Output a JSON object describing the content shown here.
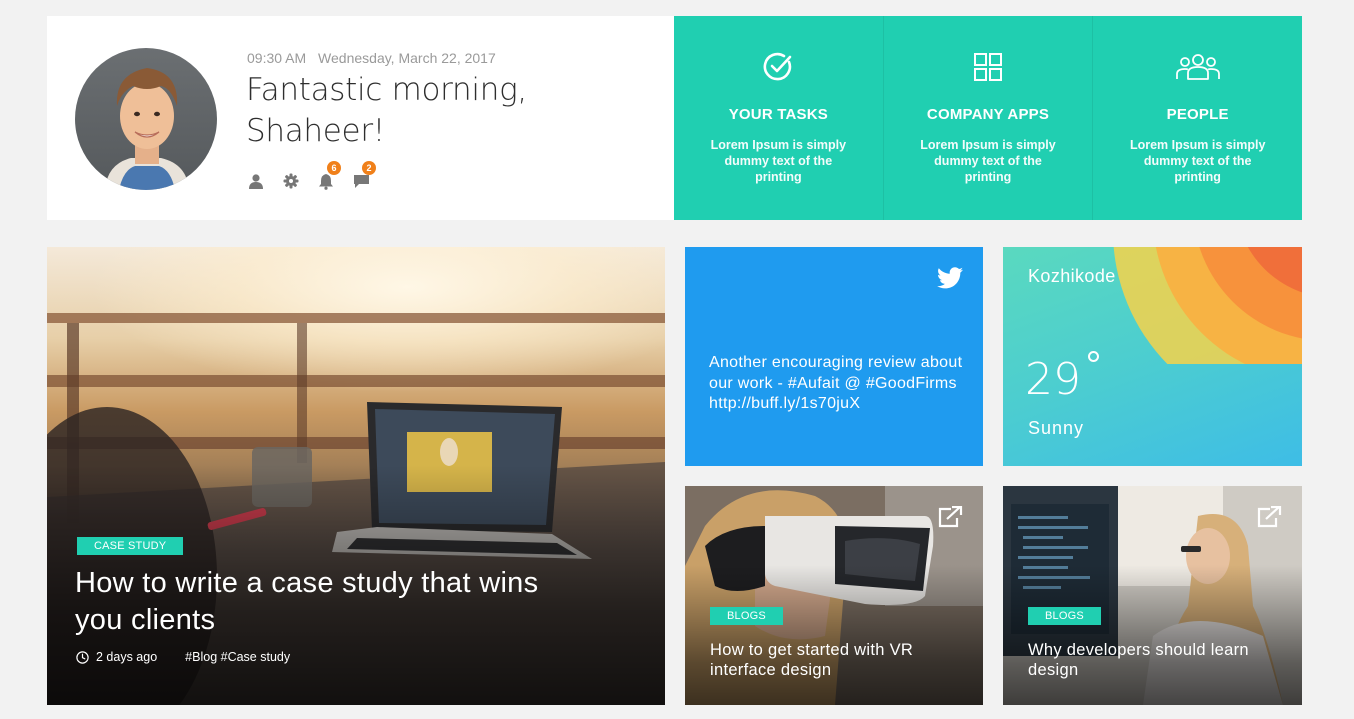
{
  "profile": {
    "time": "09:30 AM",
    "date": "Wednesday, March 22, 2017",
    "greeting_line1": "Fantastic morning,",
    "greeting_line2": "Shaheer!",
    "notifications_count": "6",
    "messages_count": "2"
  },
  "quick_links": [
    {
      "icon": "check-circle-icon",
      "title": "YOUR TASKS",
      "desc": "Lorem Ipsum is simply dummy text of the printing"
    },
    {
      "icon": "grid-apps-icon",
      "title": "COMPANY APPS",
      "desc": "Lorem Ipsum is simply dummy text of the printing"
    },
    {
      "icon": "people-icon",
      "title": "PEOPLE",
      "desc": "Lorem Ipsum is simply dummy text of the printing"
    }
  ],
  "feature": {
    "tag": "CASE STUDY",
    "title": "How to write a case study that wins you clients",
    "time_ago": "2 days ago",
    "hashtags": "#Blog #Case study"
  },
  "tweet": {
    "text": "Another encouraging review about our work - #Aufait @ #GoodFirms http://buff.ly/1s70juX"
  },
  "weather": {
    "city": "Kozhikode",
    "temperature": "29",
    "condition": "Sunny"
  },
  "blogs": [
    {
      "tag": "BLOGS",
      "title": "How to get started with VR interface design"
    },
    {
      "tag": "BLOGS",
      "title": "Why developers should learn design"
    }
  ],
  "colors": {
    "teal": "#20cfb1",
    "twitter_blue": "#1f9bef",
    "badge_orange": "#f0801a",
    "background": "#f2f2f2"
  }
}
